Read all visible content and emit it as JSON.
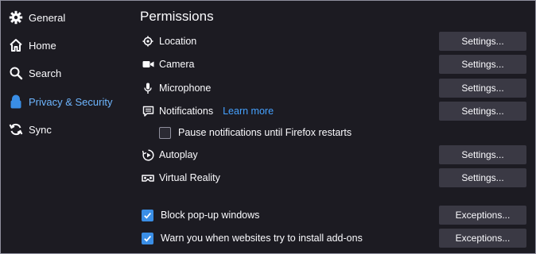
{
  "sidebar": {
    "items": [
      {
        "label": "General",
        "icon": "gear-icon"
      },
      {
        "label": "Home",
        "icon": "home-icon"
      },
      {
        "label": "Search",
        "icon": "search-icon"
      },
      {
        "label": "Privacy & Security",
        "icon": "lock-icon",
        "active": true
      },
      {
        "label": "Sync",
        "icon": "sync-icon"
      }
    ]
  },
  "permissions": {
    "title": "Permissions",
    "location": {
      "label": "Location",
      "button": "Settings..."
    },
    "camera": {
      "label": "Camera",
      "button": "Settings..."
    },
    "microphone": {
      "label": "Microphone",
      "button": "Settings..."
    },
    "notifications": {
      "label": "Notifications",
      "link": "Learn more",
      "button": "Settings..."
    },
    "pause_notifications": {
      "label": "Pause notifications until Firefox restarts",
      "checked": false
    },
    "autoplay": {
      "label": "Autoplay",
      "button": "Settings..."
    },
    "virtual_reality": {
      "label": "Virtual Reality",
      "button": "Settings..."
    },
    "block_popups": {
      "label": "Block pop-up windows",
      "checked": true,
      "button": "Exceptions..."
    },
    "warn_addons": {
      "label": "Warn you when websites try to install add-ons",
      "checked": true,
      "button": "Exceptions..."
    }
  },
  "colors": {
    "background": "#1c1b22",
    "button": "#3a3944",
    "accent": "#3a8ee6",
    "link": "#45a1ff"
  }
}
